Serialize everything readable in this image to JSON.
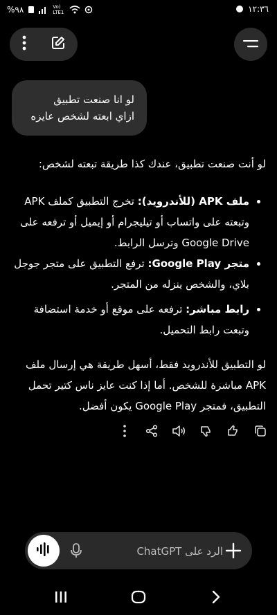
{
  "status_bar": {
    "battery_text": "%٩٨",
    "network_text": "Vo) LTE1",
    "time": "١٢:٣٦"
  },
  "user_message": {
    "line1": "لو انا صنعت تطبيق",
    "line2": "ازاي ابعته لشخص عايزه"
  },
  "answer": {
    "intro": "لو أنت صنعت تطبيق، عندك كذا طريقة تبعته لشخص:",
    "bullets": [
      {
        "bold": "ملف APK (للأندرويد):",
        "text": " تخرج التطبيق كملف APK وتبعته على واتساب أو تيليجرام أو إيميل أو ترفعه على Google Drive وترسل الرابط."
      },
      {
        "bold": "متجر Google Play:",
        "text": " ترفع التطبيق على متجر جوجل بلاي، والشخص ينزله من المتجر."
      },
      {
        "bold": "رابط مباشر:",
        "text": " ترفعه على موقع أو خدمة استضافة وتبعت رابط التحميل."
      }
    ],
    "closing": "لو التطبيق للأندرويد فقط، أسهل طريقة هي إرسال ملف APK مباشرة للشخص. أما إذا كنت عايز ناس كتير تحمل التطبيق، فمتجر Google Play يكون أفضل."
  },
  "composer": {
    "placeholder": "الرد على ChatGPT"
  },
  "icons": {
    "menu": "more-vertical-icon",
    "new_chat": "edit-icon",
    "sidebar": "hamburger-icon",
    "copy": "copy-icon",
    "like": "thumbs-up-icon",
    "dislike": "thumbs-down-icon",
    "speak": "speaker-icon",
    "share": "share-icon",
    "more": "more-vertical-icon",
    "voice": "voice-waveform-icon",
    "mic": "mic-icon",
    "plus": "plus-icon"
  }
}
